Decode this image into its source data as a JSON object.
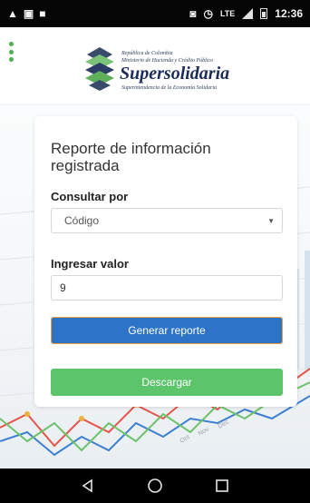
{
  "status_bar": {
    "left_icons": [
      "warning-icon",
      "image-icon",
      "message-icon"
    ],
    "right_icons": [
      "cast-icon",
      "alarm-icon"
    ],
    "network": "LTE",
    "time": "12:36"
  },
  "header": {
    "menu_icon": "vertical-dots-menu-icon",
    "logo": {
      "line1": "República de Colombia",
      "line2": "Ministerio de Hacienda y Crédito Público",
      "title": "Supersolidaria",
      "subtitle": "Superintendencia de la Economía Solidaria"
    }
  },
  "form": {
    "title": "Reporte de información registrada",
    "consultar_label": "Consultar por",
    "consultar_selected": "Código",
    "ingresar_label": "Ingresar valor",
    "ingresar_value": "9",
    "generate_button": "Generar reporte",
    "download_button": "Descargar"
  },
  "background": {
    "month_labels": [
      "Oct",
      "Nov",
      "Dec"
    ]
  },
  "colors": {
    "primary": "#2d74c8",
    "primary_border": "#e4a03a",
    "success": "#5cc46a",
    "menu": "#4caf50",
    "brand_text": "#1c2c5a"
  },
  "nav_bar": {
    "icons": [
      "back-icon",
      "home-icon",
      "recents-icon"
    ]
  }
}
